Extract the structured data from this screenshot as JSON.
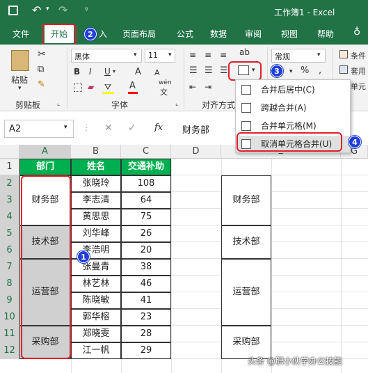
{
  "window": {
    "title": "工作簿1 - Excel"
  },
  "tabs": [
    {
      "label": "文件"
    },
    {
      "label": "开始"
    },
    {
      "label": "入"
    },
    {
      "label": "页面布局"
    },
    {
      "label": "公式"
    },
    {
      "label": "数据"
    },
    {
      "label": "审阅"
    },
    {
      "label": "视图"
    },
    {
      "label": "帮助"
    }
  ],
  "ribbon": {
    "paste_label": "粘贴",
    "clipboard_label": "剪贴板",
    "font_name": "黑体",
    "font_size": "11",
    "font_group_label": "字体",
    "align_group_label": "对齐方式",
    "number_format": "常规",
    "percent_symbol": "%",
    "cond_format": "条件",
    "table_format": "套用",
    "cell_style": "单元",
    "bold": "B",
    "italic": "I",
    "underline": "U",
    "grow_font": "A",
    "shrink_font": "A",
    "wen": "wén",
    "wen_char": "文"
  },
  "merge_menu": {
    "items": [
      {
        "label": "合并后居中(C)"
      },
      {
        "label": "跨越合并(A)"
      },
      {
        "label": "合并单元格(M)"
      },
      {
        "label": "取消单元格合并(U)"
      }
    ]
  },
  "formula_bar": {
    "name_box": "A2",
    "fx": "fx",
    "value": "财务部"
  },
  "columns": [
    "A",
    "B",
    "C",
    "D",
    "E",
    "G"
  ],
  "rows": [
    "1",
    "2",
    "3",
    "4",
    "5",
    "6",
    "7",
    "8",
    "9",
    "10",
    "11",
    "12"
  ],
  "table": {
    "headers": [
      "部门",
      "姓名",
      "交通补助"
    ],
    "names": [
      "张晓玲",
      "李志清",
      "黄思思",
      "刘华峰",
      "李浩明",
      "张曼青",
      "林艺林",
      "陈晓敏",
      "郭华榕",
      "郑晓雯",
      "江一帆"
    ],
    "amounts": [
      "108",
      "64",
      "75",
      "26",
      "20",
      "38",
      "46",
      "41",
      "23",
      "28",
      "29"
    ],
    "departments": [
      "财务部",
      "技术部",
      "运营部",
      "采购部"
    ]
  },
  "right_table": {
    "departments": [
      "财务部",
      "技术部",
      "运营部",
      "采购部"
    ]
  },
  "badges": [
    "1",
    "2",
    "3",
    "4"
  ],
  "watermark": "头条 @职小伙学办公技能",
  "colors": {
    "excel_green": "#217346",
    "header_green": "#00b050",
    "annotation_red": "#e0202a",
    "badge_blue": "#1f3fd9"
  }
}
